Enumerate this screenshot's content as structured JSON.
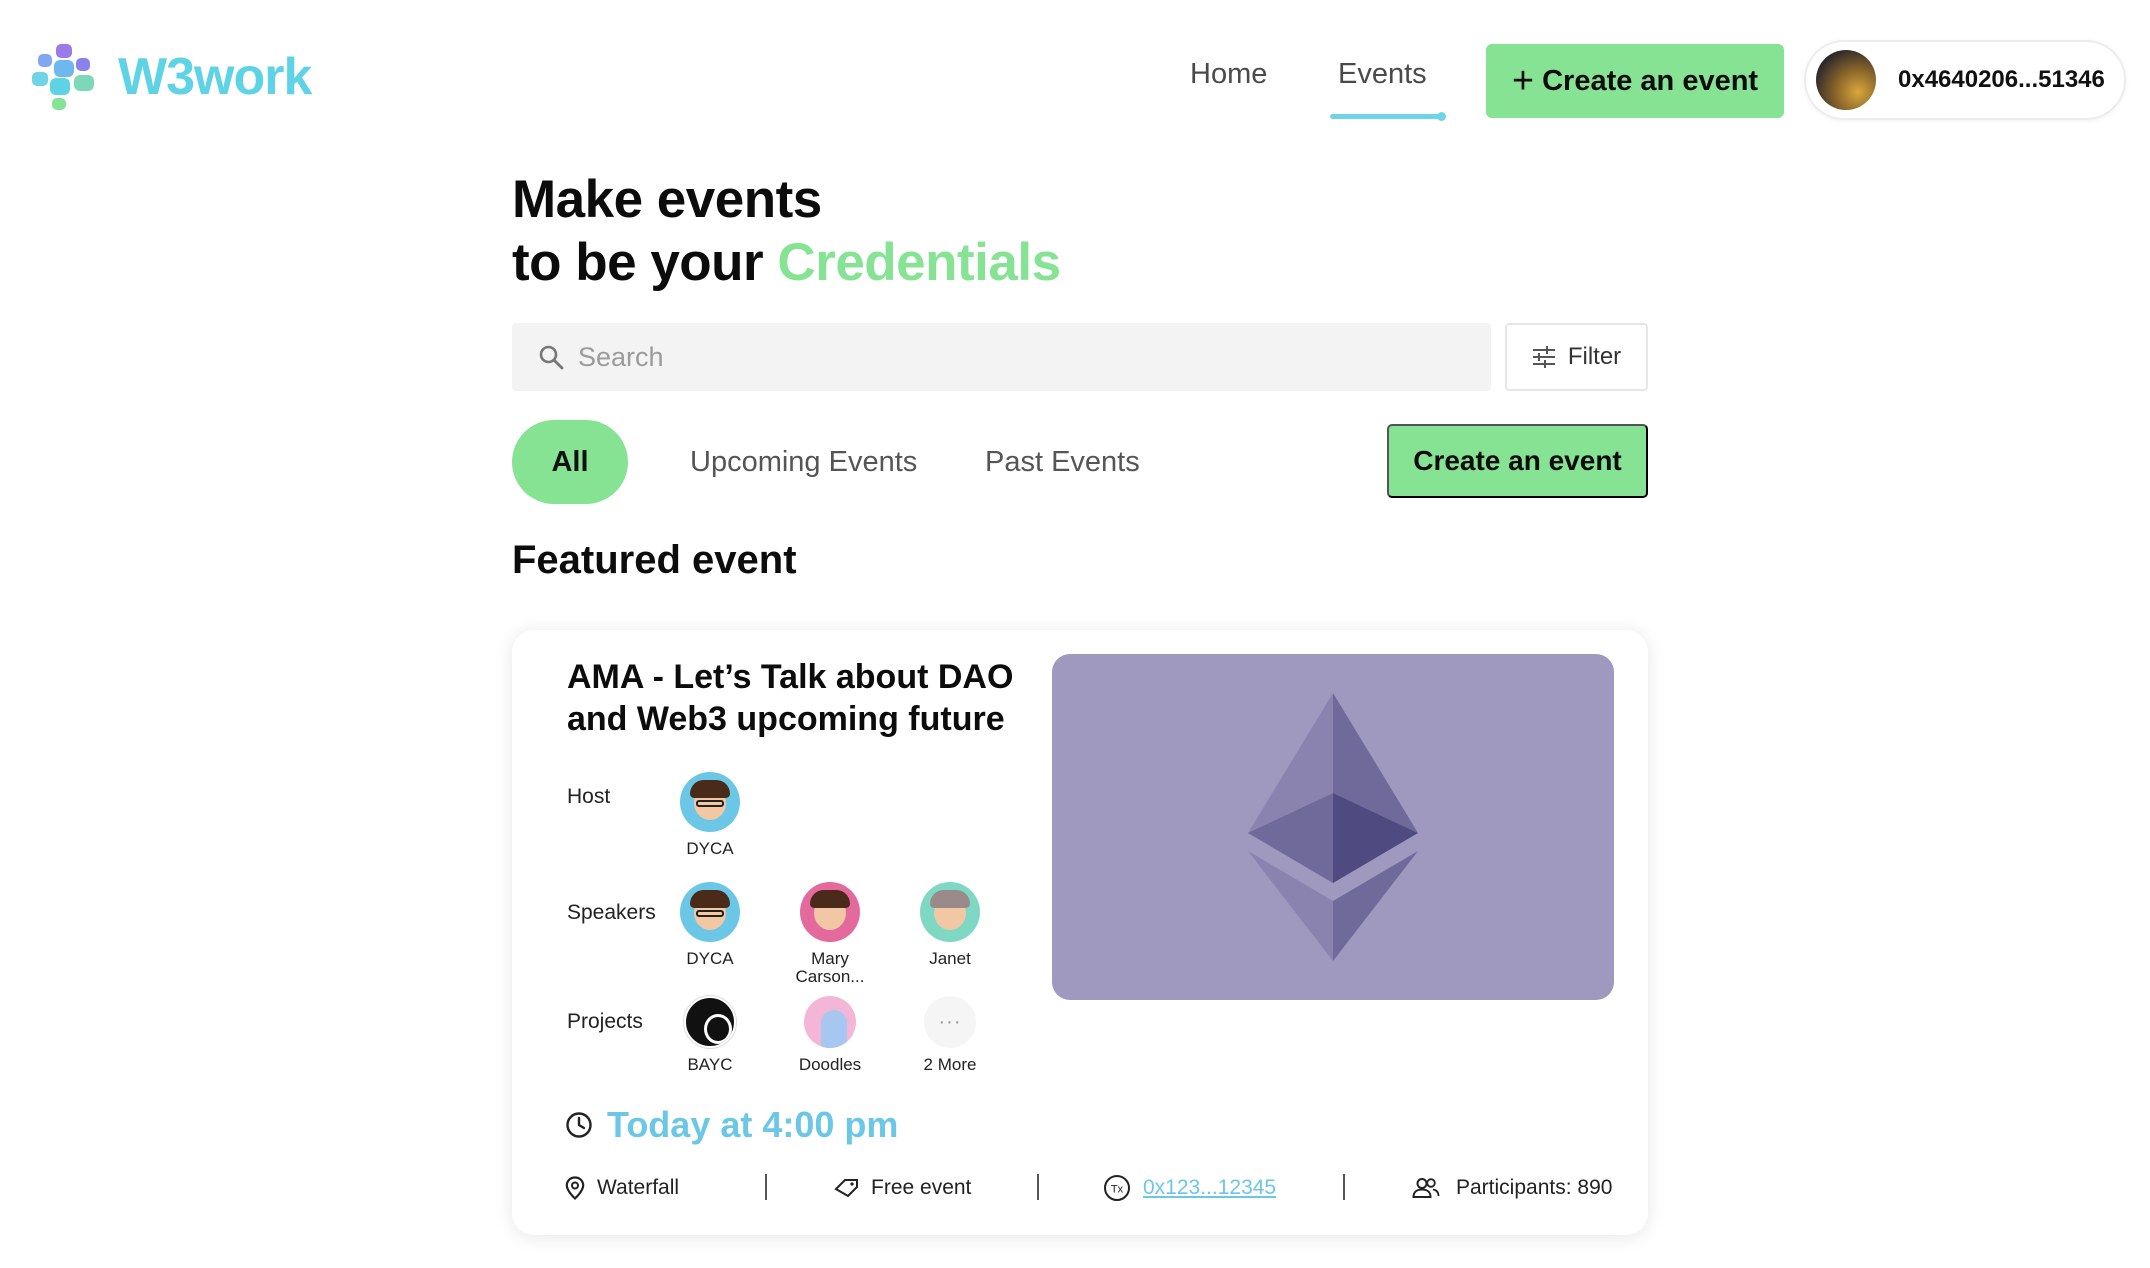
{
  "brand": {
    "name": "W3work"
  },
  "nav": {
    "home": "Home",
    "events": "Events",
    "create_event_label": "Create an event"
  },
  "wallet": {
    "address": "0x4640206...51346"
  },
  "hero": {
    "line1": "Make events",
    "line2_prefix": "to be your",
    "line2_accent": "Credentials"
  },
  "search": {
    "placeholder": "Search"
  },
  "filter": {
    "label": "Filter"
  },
  "tabs": {
    "all": "All",
    "upcoming": "Upcoming Events",
    "past": "Past Events",
    "active": "All"
  },
  "create_event_button": "Create an event",
  "featured": {
    "section_title": "Featured event",
    "title": "AMA - Let’s Talk about DAO and Web3 upcoming future",
    "host_label": "Host",
    "speakers_label": "Speakers",
    "projects_label": "Projects",
    "host": [
      {
        "name": "DYCA"
      }
    ],
    "speakers": [
      {
        "name": "DYCA"
      },
      {
        "name": "Mary Carson..."
      },
      {
        "name": "Janet"
      }
    ],
    "projects": [
      {
        "name": "BAYC"
      },
      {
        "name": "Doodles"
      },
      {
        "name": "2 More"
      }
    ],
    "time": "Today at 4:00 pm",
    "location": "Waterfall",
    "price": "Free event",
    "tx": "0x123...12345",
    "tx_icon_label": "Tx",
    "participants": "Participants: 890"
  },
  "colors": {
    "accent_green": "#86e394",
    "accent_blue": "#6cc6e6",
    "eth_panel": "#9f98bf"
  }
}
